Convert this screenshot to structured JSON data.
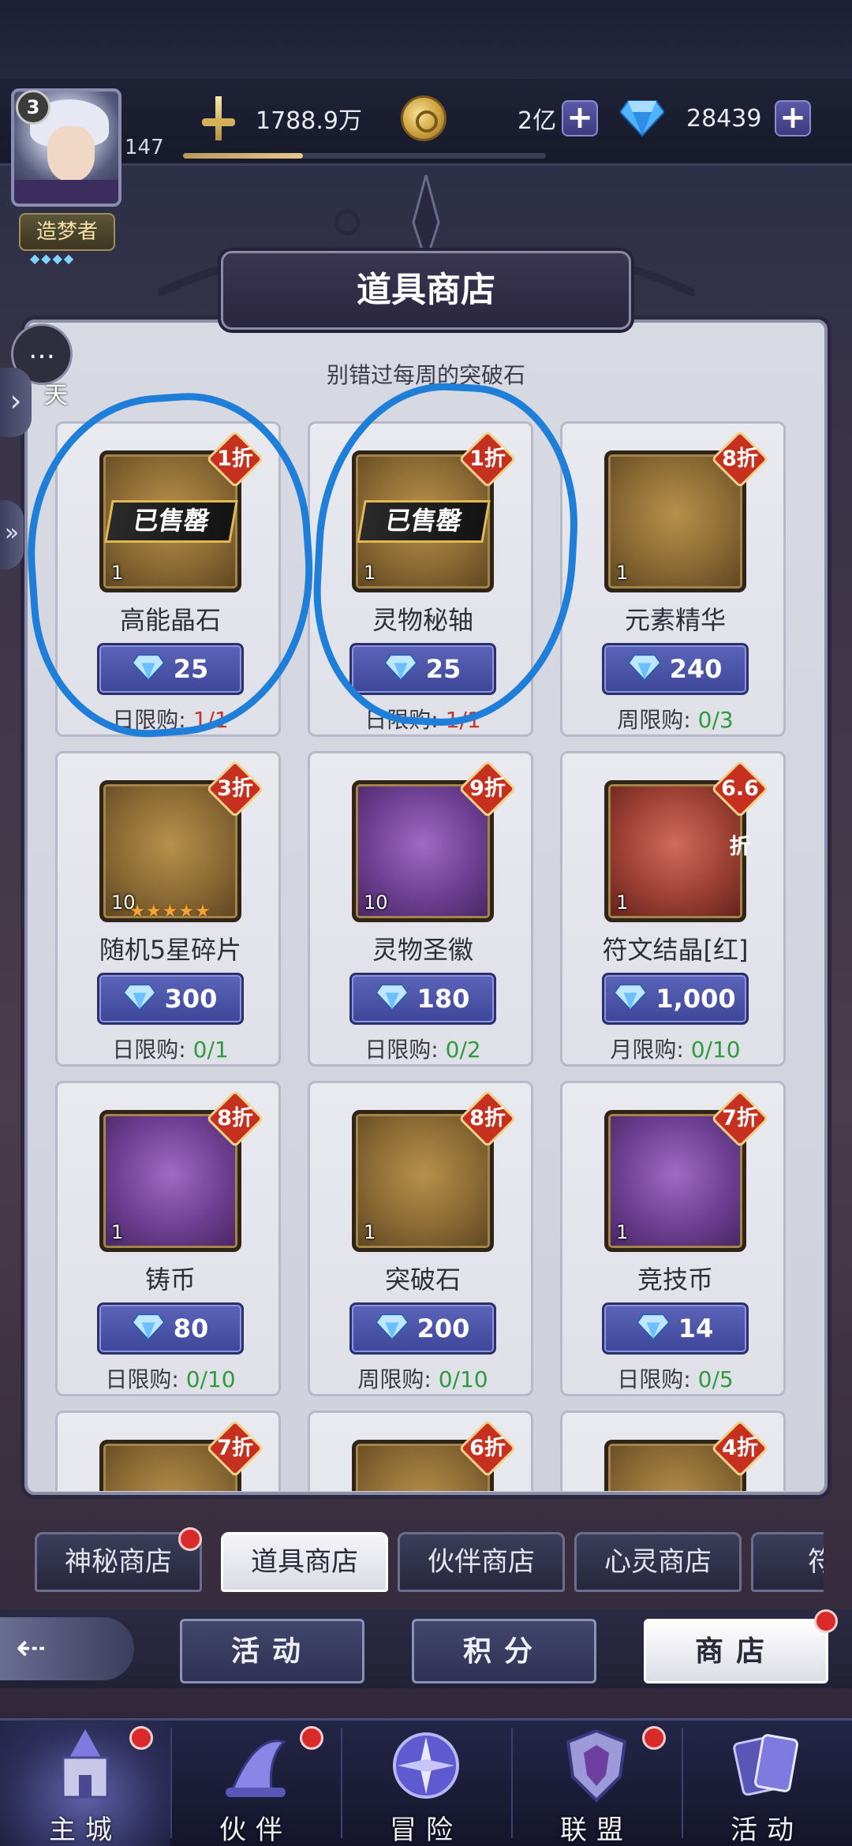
{
  "player": {
    "level": "3",
    "exp_level": "147",
    "exp_progress": 0.33,
    "title": "造梦者",
    "title_stars": "◆◆◆◆"
  },
  "resources": {
    "power": "1788.9万",
    "gold": "2亿",
    "diamonds": "28439"
  },
  "shop": {
    "title": "道具商店",
    "subtitle": "别错过每周的突破石",
    "sold_out_label": "已售罄",
    "items": [
      {
        "name": "高能晶石",
        "qty": "1",
        "discount": "1折",
        "price": "25",
        "limit_label": "日限购:",
        "limit_count": "1/1",
        "sold_out": true,
        "frame": "gold"
      },
      {
        "name": "灵物秘轴",
        "qty": "1",
        "discount": "1折",
        "price": "25",
        "limit_label": "日限购:",
        "limit_count": "1/1",
        "sold_out": true,
        "frame": "gold"
      },
      {
        "name": "元素精华",
        "qty": "1",
        "discount": "8折",
        "price": "240",
        "limit_label": "周限购:",
        "limit_count": "0/3",
        "sold_out": false,
        "frame": "gold"
      },
      {
        "name": "随机5星碎片",
        "qty": "10",
        "discount": "3折",
        "price": "300",
        "limit_label": "日限购:",
        "limit_count": "0/1",
        "sold_out": false,
        "frame": "gold",
        "stars": "★★★★★"
      },
      {
        "name": "灵物圣徽",
        "qty": "10",
        "discount": "9折",
        "price": "180",
        "limit_label": "日限购:",
        "limit_count": "0/2",
        "sold_out": false,
        "frame": "purple"
      },
      {
        "name": "符文结晶[红]",
        "qty": "1",
        "discount": "6.6折",
        "price": "1,000",
        "limit_label": "月限购:",
        "limit_count": "0/10",
        "sold_out": false,
        "frame": "red"
      },
      {
        "name": "铸币",
        "qty": "1",
        "discount": "8折",
        "price": "80",
        "limit_label": "日限购:",
        "limit_count": "0/10",
        "sold_out": false,
        "frame": "purple"
      },
      {
        "name": "突破石",
        "qty": "1",
        "discount": "8折",
        "price": "200",
        "limit_label": "周限购:",
        "limit_count": "0/10",
        "sold_out": false,
        "frame": "gold"
      },
      {
        "name": "竞技币",
        "qty": "1",
        "discount": "7折",
        "price": "14",
        "limit_label": "日限购:",
        "limit_count": "0/5",
        "sold_out": false,
        "frame": "purple"
      },
      {
        "name": "",
        "qty": "",
        "discount": "7折",
        "price": "",
        "limit_label": "",
        "limit_count": "",
        "sold_out": false,
        "frame": "gold"
      },
      {
        "name": "",
        "qty": "",
        "discount": "6折",
        "price": "",
        "limit_label": "",
        "limit_count": "",
        "sold_out": false,
        "frame": "gold"
      },
      {
        "name": "",
        "qty": "",
        "discount": "4折",
        "price": "",
        "limit_label": "",
        "limit_count": "",
        "sold_out": false,
        "frame": "gold"
      }
    ]
  },
  "side": {
    "chat_label": "天"
  },
  "tabs": [
    "神秘商店",
    "道具商店",
    "伙伴商店",
    "心灵商店",
    "符石"
  ],
  "subnav": [
    "活动",
    "积分",
    "商店"
  ],
  "bottom_nav": [
    "主城",
    "伙伴",
    "冒险",
    "联盟",
    "活动"
  ],
  "colors": {
    "accent_blue": "#1f7fd8",
    "limit_full": "#c0392b",
    "limit_open": "#2e9b3d",
    "discount_red": "#c5301f"
  },
  "icons": {
    "power": "sword-icon",
    "gold": "coin-icon",
    "diamond": "diamond-icon",
    "plus": "plus-icon",
    "chat": "chat-bubble-icon",
    "back": "back-arrow-icon"
  }
}
